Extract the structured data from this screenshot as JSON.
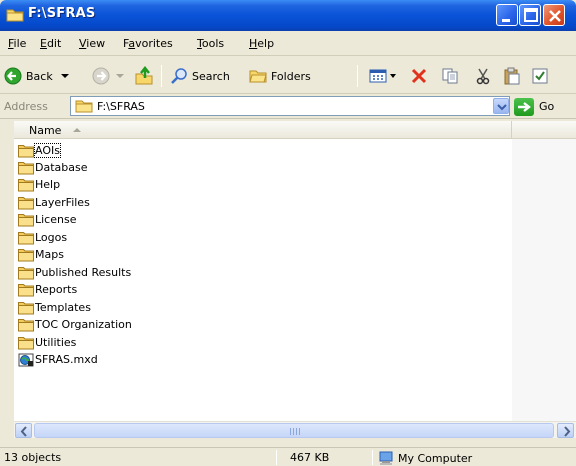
{
  "window": {
    "title": "F:\\SFRAS"
  },
  "menu": [
    {
      "label": "File",
      "key": "F",
      "rest": "ile"
    },
    {
      "label": "Edit",
      "key": "E",
      "rest": "dit"
    },
    {
      "label": "View",
      "key": "V",
      "rest": "iew"
    },
    {
      "label": "Favorites",
      "key": "a",
      "pre": "F",
      "rest": "vorites"
    },
    {
      "label": "Tools",
      "key": "T",
      "rest": "ools"
    },
    {
      "label": "Help",
      "key": "H",
      "rest": "elp"
    }
  ],
  "toolbar": {
    "back_label": "Back",
    "search_label": "Search",
    "folders_label": "Folders"
  },
  "address": {
    "label": "Address",
    "value": "F:\\SFRAS",
    "go_label": "Go"
  },
  "list": {
    "column_name": "Name",
    "items": [
      {
        "name": "AOIs",
        "type": "folder",
        "selected": true
      },
      {
        "name": "Database",
        "type": "folder"
      },
      {
        "name": "Help",
        "type": "folder"
      },
      {
        "name": "LayerFiles",
        "type": "folder"
      },
      {
        "name": "License",
        "type": "folder"
      },
      {
        "name": "Logos",
        "type": "folder"
      },
      {
        "name": "Maps",
        "type": "folder"
      },
      {
        "name": "Published Results",
        "type": "folder"
      },
      {
        "name": "Reports",
        "type": "folder"
      },
      {
        "name": "Templates",
        "type": "folder"
      },
      {
        "name": "TOC Organization",
        "type": "folder"
      },
      {
        "name": "Utilities",
        "type": "folder"
      },
      {
        "name": "SFRAS.mxd",
        "type": "mxd-file"
      }
    ]
  },
  "status": {
    "objects": "13 objects",
    "size": "467 KB",
    "location": "My Computer"
  }
}
